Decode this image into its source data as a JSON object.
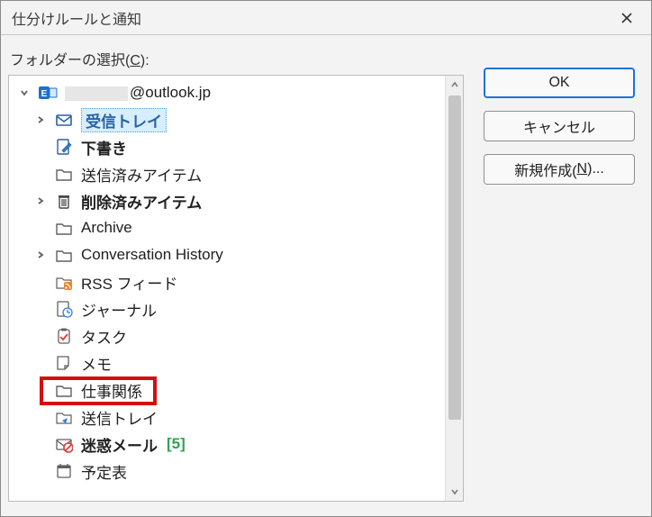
{
  "dialog": {
    "title": "仕分けルールと通知"
  },
  "labels": {
    "folder_select": "フォルダーの選択(",
    "folder_select_accel": "C",
    "folder_select_post": "):"
  },
  "tree": {
    "root_label": "@outlook.jp",
    "items": [
      {
        "id": "inbox",
        "label": "受信トレイ",
        "bold": true,
        "selected": true,
        "expander": true
      },
      {
        "id": "drafts",
        "label": "下書き",
        "bold": true,
        "selected": false,
        "expander": false
      },
      {
        "id": "sent",
        "label": "送信済みアイテム",
        "bold": false,
        "selected": false,
        "expander": false
      },
      {
        "id": "deleted",
        "label": "削除済みアイテム",
        "bold": true,
        "selected": false,
        "expander": true
      },
      {
        "id": "archive",
        "label": "Archive",
        "bold": false,
        "selected": false,
        "expander": false
      },
      {
        "id": "convhist",
        "label": "Conversation History",
        "bold": false,
        "selected": false,
        "expander": true
      },
      {
        "id": "rss",
        "label": "RSS フィード",
        "bold": false,
        "selected": false,
        "expander": false
      },
      {
        "id": "journal",
        "label": "ジャーナル",
        "bold": false,
        "selected": false,
        "expander": false
      },
      {
        "id": "tasks",
        "label": "タスク",
        "bold": false,
        "selected": false,
        "expander": false
      },
      {
        "id": "notes",
        "label": "メモ",
        "bold": false,
        "selected": false,
        "expander": false
      },
      {
        "id": "work",
        "label": "仕事関係",
        "bold": false,
        "selected": false,
        "expander": false,
        "redbox": true
      },
      {
        "id": "outbox",
        "label": "送信トレイ",
        "bold": false,
        "selected": false,
        "expander": false
      },
      {
        "id": "junk",
        "label": "迷惑メール",
        "bold": true,
        "selected": false,
        "expander": false,
        "count": "[5]"
      },
      {
        "id": "calendar",
        "label": "予定表",
        "bold": false,
        "selected": false,
        "expander": false
      }
    ]
  },
  "buttons": {
    "ok": "OK",
    "cancel": "キャンセル",
    "new_pre": "新規作成(",
    "new_accel": "N",
    "new_post": ")..."
  }
}
